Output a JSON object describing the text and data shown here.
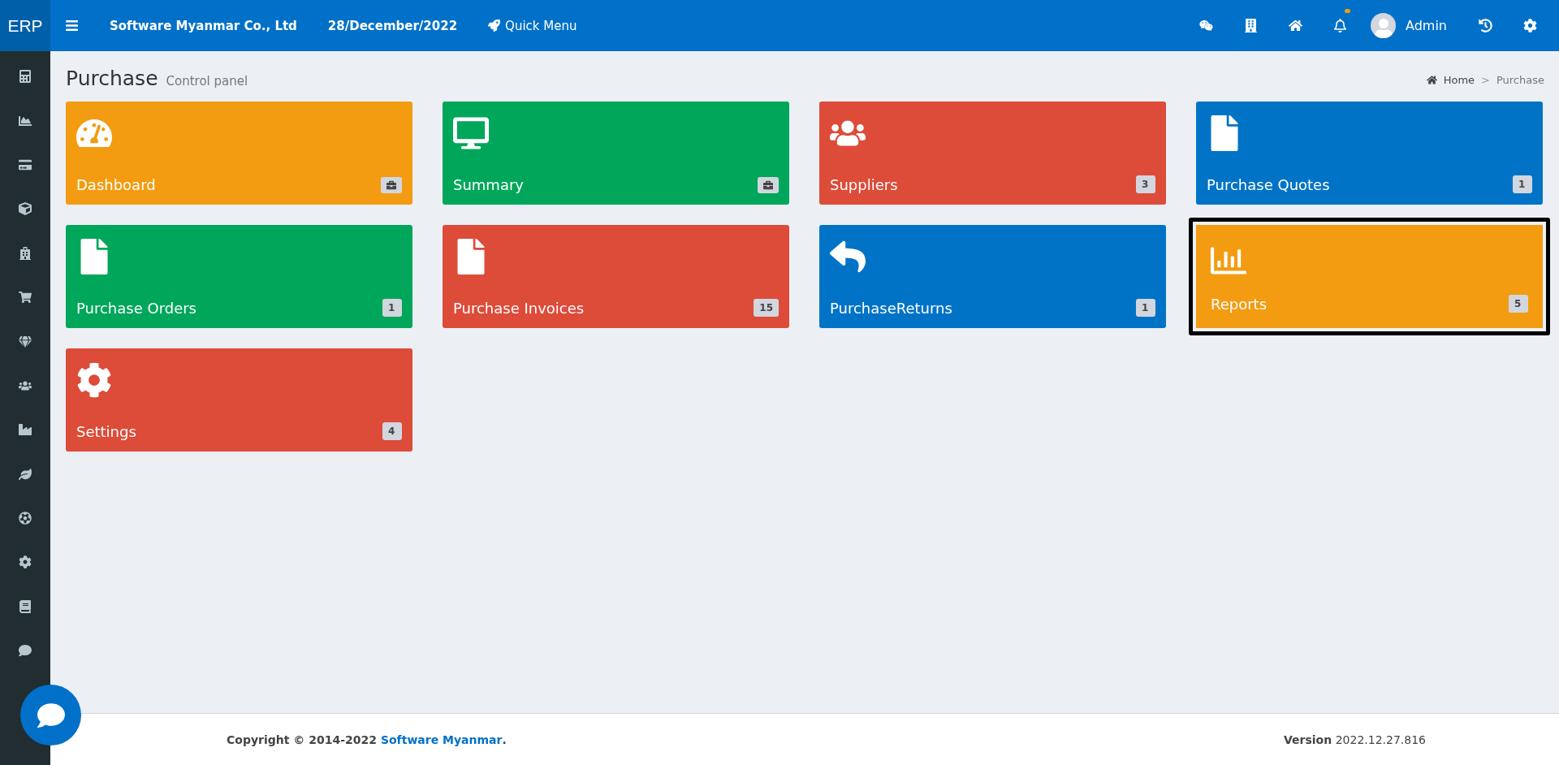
{
  "brand": {
    "logo": "ERP"
  },
  "topbar": {
    "company": "Software Myanmar Co., Ltd",
    "date": "28/December/2022",
    "quick_menu": "Quick Menu",
    "bell_unread": true,
    "user": "Admin"
  },
  "page": {
    "title": "Purchase",
    "subtitle": "Control panel"
  },
  "breadcrumb": [
    {
      "label": "Home"
    },
    {
      "label": "Purchase"
    }
  ],
  "breadcrumb_separator": ">",
  "tiles": [
    {
      "label": "Dashboard",
      "color": "#f39c12",
      "selected": false
    },
    {
      "label": "Summary",
      "color": "#00a65a",
      "selected": false
    },
    {
      "label": "Suppliers",
      "color": "#dd4b39",
      "count": "3",
      "selected": false
    },
    {
      "label": "Purchase Quotes",
      "color": "#0073c7",
      "count": "1",
      "selected": false
    },
    {
      "label": "Purchase Orders",
      "color": "#00a65a",
      "count": "1",
      "selected": false
    },
    {
      "label": "Purchase Invoices",
      "color": "#dd4b39",
      "count": "15",
      "selected": false
    },
    {
      "label": "PurchaseReturns",
      "color": "#0073c7",
      "count": "1",
      "selected": false
    },
    {
      "label": "Reports",
      "color": "#f39c12",
      "count": "5",
      "selected": true
    },
    {
      "label": "Settings",
      "color": "#dd4b39",
      "count": "4",
      "selected": false
    }
  ],
  "footer": {
    "copyright": "Copyright © 2014-2022",
    "company_link": "Software Myanmar",
    "period": ".",
    "version_label": "Version",
    "version": "2022.12.27.816"
  }
}
